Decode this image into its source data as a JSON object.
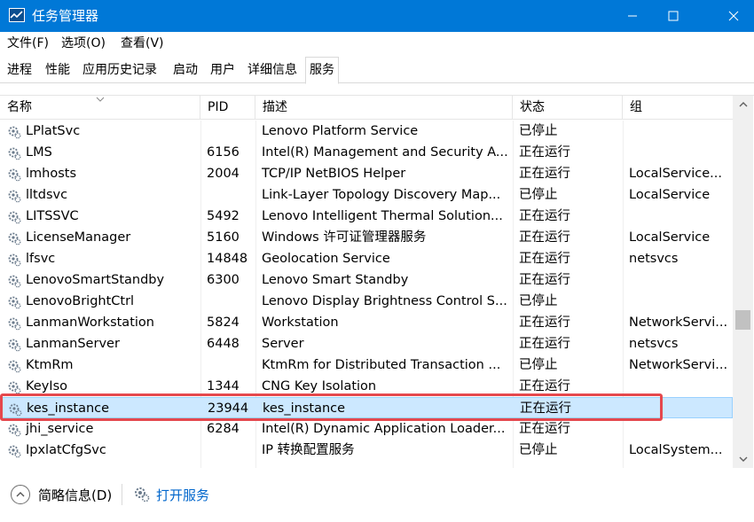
{
  "window": {
    "title": "任务管理器",
    "accent": "#0078d7"
  },
  "menu": [
    "文件(F)",
    "选项(O)",
    "查看(V)"
  ],
  "tabs": [
    "进程",
    "性能",
    "应用历史记录",
    "启动",
    "用户",
    "详细信息",
    "服务"
  ],
  "active_tab": "服务",
  "columns": {
    "name": "名称",
    "pid": "PID",
    "desc": "描述",
    "status": "状态",
    "group": "组"
  },
  "rows": [
    {
      "name": "LPlatSvc",
      "pid": "",
      "desc": "Lenovo Platform Service",
      "status": "已停止",
      "group": ""
    },
    {
      "name": "LMS",
      "pid": "6156",
      "desc": "Intel(R) Management and Security A...",
      "status": "正在运行",
      "group": ""
    },
    {
      "name": "lmhosts",
      "pid": "2004",
      "desc": "TCP/IP NetBIOS Helper",
      "status": "正在运行",
      "group": "LocalService..."
    },
    {
      "name": "lltdsvc",
      "pid": "",
      "desc": "Link-Layer Topology Discovery Map...",
      "status": "已停止",
      "group": "LocalService"
    },
    {
      "name": "LITSSVC",
      "pid": "5492",
      "desc": "Lenovo Intelligent Thermal Solution...",
      "status": "正在运行",
      "group": ""
    },
    {
      "name": "LicenseManager",
      "pid": "5160",
      "desc": "Windows 许可证管理器服务",
      "status": "正在运行",
      "group": "LocalService"
    },
    {
      "name": "lfsvc",
      "pid": "14848",
      "desc": "Geolocation Service",
      "status": "正在运行",
      "group": "netsvcs"
    },
    {
      "name": "LenovoSmartStandby",
      "pid": "6300",
      "desc": "Lenovo Smart Standby",
      "status": "正在运行",
      "group": ""
    },
    {
      "name": "LenovoBrightCtrl",
      "pid": "",
      "desc": "Lenovo Display Brightness Control S...",
      "status": "已停止",
      "group": ""
    },
    {
      "name": "LanmanWorkstation",
      "pid": "5824",
      "desc": "Workstation",
      "status": "正在运行",
      "group": "NetworkServi..."
    },
    {
      "name": "LanmanServer",
      "pid": "6448",
      "desc": "Server",
      "status": "正在运行",
      "group": "netsvcs"
    },
    {
      "name": "KtmRm",
      "pid": "",
      "desc": "KtmRm for Distributed Transaction ...",
      "status": "已停止",
      "group": "NetworkServi..."
    },
    {
      "name": "KeyIso",
      "pid": "1344",
      "desc": "CNG Key Isolation",
      "status": "正在运行",
      "group": ""
    },
    {
      "name": "kes_instance",
      "pid": "23944",
      "desc": "kes_instance",
      "status": "正在运行",
      "group": "",
      "selected": true
    },
    {
      "name": "jhi_service",
      "pid": "6284",
      "desc": "Intel(R) Dynamic Application Loader...",
      "status": "正在运行",
      "group": ""
    },
    {
      "name": "IpxlatCfgSvc",
      "pid": "",
      "desc": "IP 转换配置服务",
      "status": "已停止",
      "group": "LocalSystem..."
    }
  ],
  "footer": {
    "fewer_details": "简略信息(D)",
    "open_services": "打开服务"
  },
  "colors": {
    "selected_row": "#cce8ff",
    "highlight_box": "#e5484d",
    "link": "#0066cc"
  }
}
